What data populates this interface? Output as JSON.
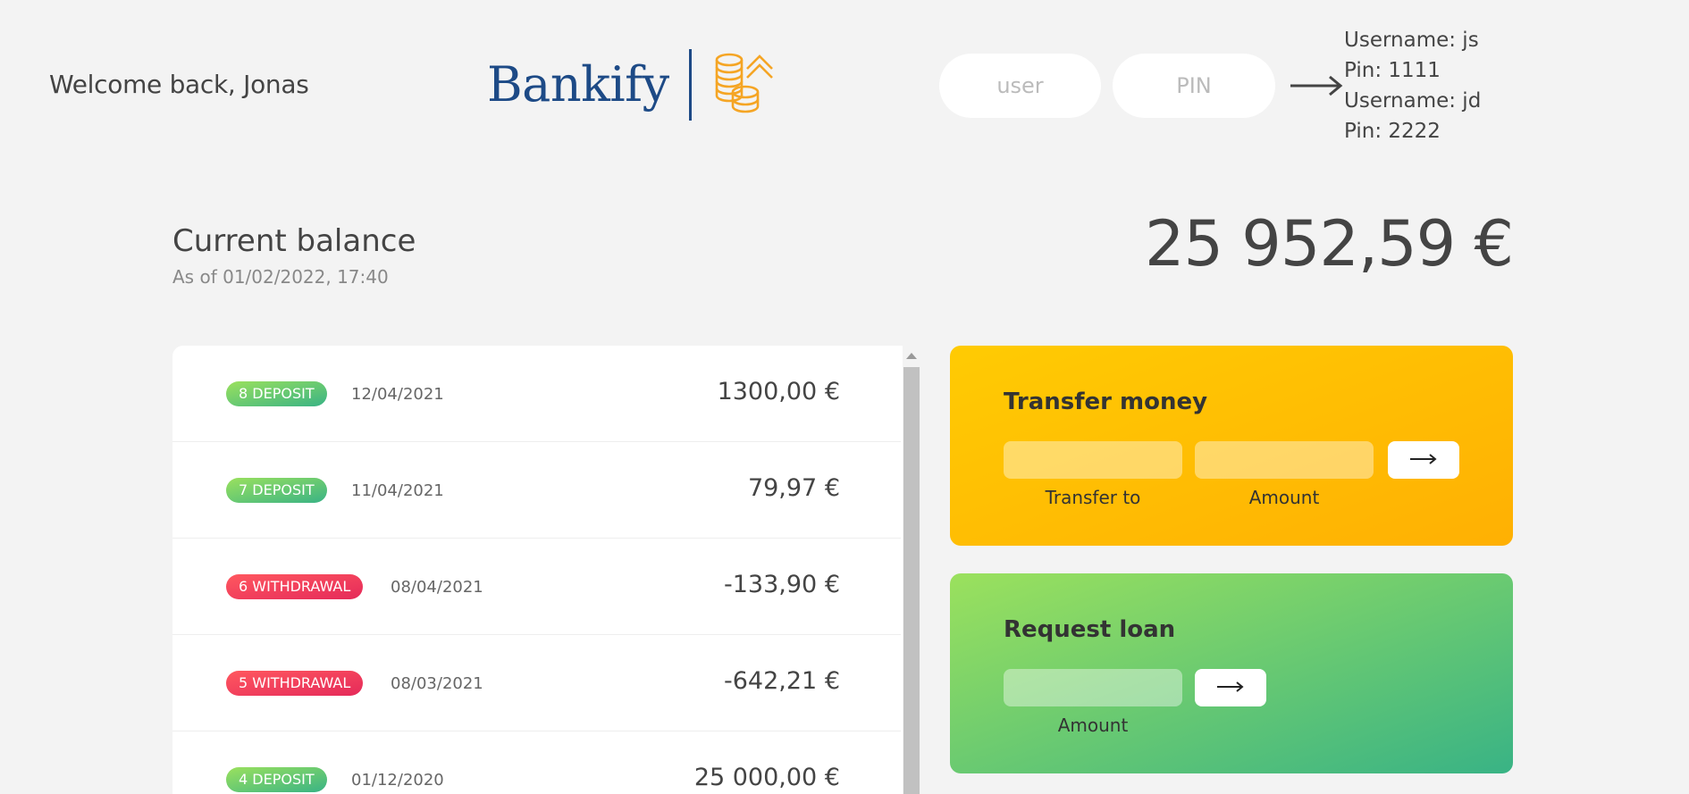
{
  "nav": {
    "welcome": "Welcome back, Jonas",
    "logo": {
      "wordmark": "Bankify",
      "icon": "coins-arrow-up-icon",
      "brand_color": "#1d4a86",
      "icon_color": "#f5a524"
    },
    "login": {
      "user_placeholder": "user",
      "pin_placeholder": "PIN",
      "button_icon": "arrow-right-icon"
    },
    "credentials_hint": [
      "Username: js",
      "Pin: 1111",
      "Username: jd",
      "Pin: 2222"
    ]
  },
  "balance": {
    "label": "Current balance",
    "date": "As of 01/02/2022, 17:40",
    "value": "25 952,59 €"
  },
  "movements": [
    {
      "type": "8 deposit",
      "kind": "deposit",
      "date": "12/04/2021",
      "value": "1300,00 €"
    },
    {
      "type": "7 deposit",
      "kind": "deposit",
      "date": "11/04/2021",
      "value": "79,97 €"
    },
    {
      "type": "6 withdrawal",
      "kind": "withdrawal",
      "date": "08/04/2021",
      "value": "-133,90 €"
    },
    {
      "type": "5 withdrawal",
      "kind": "withdrawal",
      "date": "08/03/2021",
      "value": "-642,21 €"
    },
    {
      "type": "4 deposit",
      "kind": "deposit",
      "date": "01/12/2020",
      "value": "25 000,00 €"
    }
  ],
  "colors": {
    "deposit": [
      "#39b385",
      "#9be15d"
    ],
    "withdrawal": [
      "#e52a5a",
      "#ff585f"
    ]
  },
  "operations": {
    "transfer": {
      "title": "Transfer money",
      "to_label": "Transfer to",
      "amount_label": "Amount",
      "to_value": "",
      "amount_value": "",
      "button_icon": "arrow-right-icon"
    },
    "loan": {
      "title": "Request loan",
      "amount_label": "Amount",
      "amount_value": "",
      "button_icon": "arrow-right-icon"
    }
  }
}
